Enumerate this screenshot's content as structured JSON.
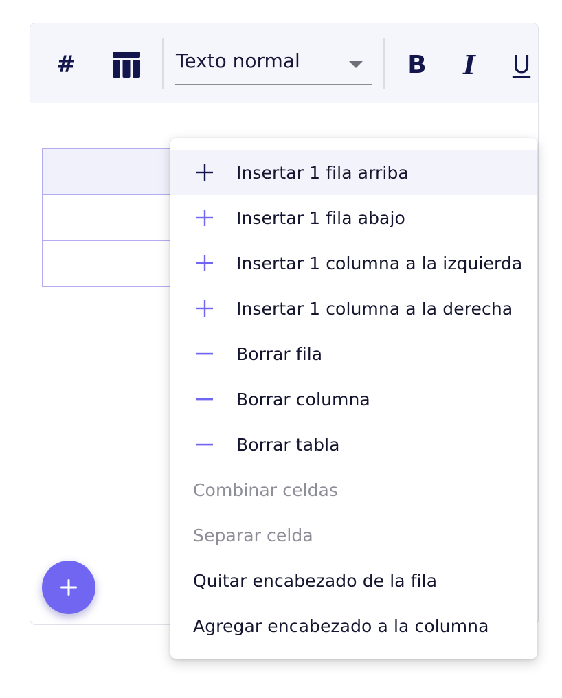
{
  "toolbar": {
    "heading_icon": "hash-icon",
    "table_icon": "table-icon",
    "text_style": "Texto normal",
    "bold_label": "B",
    "italic_label": "I",
    "underline_label": "U"
  },
  "table": {
    "rows": 3,
    "header_row": true
  },
  "fab_icon": "plus-icon",
  "context_menu": {
    "items": [
      {
        "label": "Insertar 1 fila arriba",
        "icon": "plus-icon",
        "highlighted": true
      },
      {
        "label": "Insertar 1 fila abajo",
        "icon": "plus-icon"
      },
      {
        "label": "Insertar 1 columna a la izquierda",
        "icon": "plus-icon"
      },
      {
        "label": "Insertar 1 columna a la derecha",
        "icon": "plus-icon"
      },
      {
        "label": "Borrar fila",
        "icon": "minus-icon"
      },
      {
        "label": "Borrar columna",
        "icon": "minus-icon"
      },
      {
        "label": "Borrar tabla",
        "icon": "minus-icon"
      },
      {
        "label": "Combinar celdas",
        "disabled": true
      },
      {
        "label": "Separar celda",
        "disabled": true
      },
      {
        "label": "Quitar encabezado de la fila"
      },
      {
        "label": "Agregar encabezado a la columna"
      }
    ]
  },
  "colors": {
    "accent": "#7166f1",
    "icon_dark": "#13164d",
    "toolbar_bg": "#f5f6fc",
    "highlight_bg": "#f3f3fc",
    "table_border": "#b4acf2",
    "disabled_text": "#8e8e98"
  }
}
